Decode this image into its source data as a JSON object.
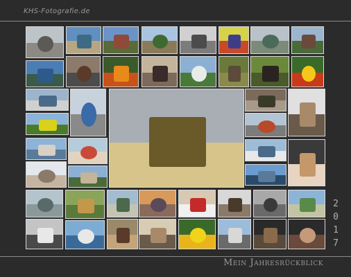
{
  "brand": "KHS-Fotografie.de",
  "caption": "Mein Jahresrückblick",
  "year_digits": [
    "2",
    "0",
    "1",
    "7"
  ],
  "photos": [
    {
      "name": "photo-bear-sculpture",
      "colors": [
        "#bcc4c8",
        "#5c5a56",
        "#8d8a83"
      ]
    },
    {
      "name": "photo-harbor",
      "colors": [
        "#5f90c0",
        "#3d6b86",
        "#b8a680"
      ]
    },
    {
      "name": "photo-holstentor",
      "colors": [
        "#6a94c8",
        "#8f4a3a",
        "#5a6b3a"
      ]
    },
    {
      "name": "photo-castle-lake",
      "colors": [
        "#a8c4e0",
        "#3f6a2f",
        "#8a7a5a"
      ]
    },
    {
      "name": "photo-half-timbered-house",
      "colors": [
        "#d0d0d0",
        "#4c4c4c",
        "#7c7c7c"
      ]
    },
    {
      "name": "photo-graffiti",
      "colors": [
        "#d6d24a",
        "#3d3d8a",
        "#c84a2a"
      ]
    },
    {
      "name": "photo-mountain-lake",
      "colors": [
        "#b8c2c8",
        "#4c6a5a",
        "#7c8a7a"
      ]
    },
    {
      "name": "photo-wooden-house",
      "colors": [
        "#9cb4cc",
        "#6a4a3a",
        "#4a6a3a"
      ]
    },
    {
      "name": "photo-fjord",
      "colors": [
        "#4c7cb4",
        "#2d5a8a",
        "#3a5a4a"
      ]
    },
    {
      "name": "photo-old-buildings",
      "colors": [
        "#8c7a6a",
        "#5c3a2a",
        "#4c4c4c"
      ]
    },
    {
      "name": "photo-orange-flowers",
      "colors": [
        "#3a5a2a",
        "#e88a1a",
        "#c8521a"
      ]
    },
    {
      "name": "photo-doorway",
      "colors": [
        "#c4b49c",
        "#3a2a2a",
        "#7c6a5a"
      ]
    },
    {
      "name": "photo-ski-jump",
      "colors": [
        "#8cb0d4",
        "#e8ece8",
        "#4a7a3a"
      ]
    },
    {
      "name": "photo-reindeer",
      "colors": [
        "#6a7a3a",
        "#5c4a3a",
        "#8a8a4a"
      ]
    },
    {
      "name": "photo-brown-bear",
      "colors": [
        "#6a8a3a",
        "#2a2420",
        "#4a5a2a"
      ]
    },
    {
      "name": "photo-yellow-flower",
      "colors": [
        "#3a6a2a",
        "#f4c81a",
        "#c83a1a"
      ]
    },
    {
      "name": "photo-marina",
      "colors": [
        "#9cb4cc",
        "#4a6a8a",
        "#d0d0d0"
      ]
    },
    {
      "name": "photo-rapeseed-field",
      "colors": [
        "#8cb4d8",
        "#d8d21a",
        "#4a7a2a"
      ]
    },
    {
      "name": "photo-signpost",
      "colors": [
        "#c8d2dc",
        "#3a6aa8",
        "#8a8a8a"
      ]
    },
    {
      "name": "photo-tram-square",
      "colors": [
        "#a8aeb4",
        "#6a5a2a",
        "#d6c48a"
      ]
    },
    {
      "name": "photo-people-crowd",
      "colors": [
        "#7c6a5a",
        "#3a3a2a",
        "#a89a8a"
      ]
    },
    {
      "name": "photo-red-building",
      "colors": [
        "#b4c4d4",
        "#b84a2a",
        "#7c7c7c"
      ]
    },
    {
      "name": "photo-lynx",
      "colors": [
        "#e0e0e0",
        "#a88a6a",
        "#6a5a4a"
      ]
    },
    {
      "name": "photo-harbor-hotel",
      "colors": [
        "#8cb4d8",
        "#d8d0c4",
        "#5a7a9a"
      ]
    },
    {
      "name": "photo-beach-chairs",
      "colors": [
        "#b4ccdc",
        "#c84a3a",
        "#e0d4c0"
      ]
    },
    {
      "name": "photo-sailing-ship",
      "colors": [
        "#9cbcd8",
        "#4a6a8a",
        "#e8e8e8"
      ]
    },
    {
      "name": "photo-woman-portrait",
      "colors": [
        "#3a3a3a",
        "#c4986a",
        "#e8d4c0"
      ]
    },
    {
      "name": "photo-husky",
      "colors": [
        "#e4e8ec",
        "#8a7a6a",
        "#c4b4a0"
      ]
    },
    {
      "name": "photo-palace",
      "colors": [
        "#8cb0d4",
        "#c4b498",
        "#4a6a3a"
      ]
    },
    {
      "name": "photo-bridge",
      "colors": [
        "#6a9cd0",
        "#5a7a9a",
        "#2a4a6a"
      ]
    },
    {
      "name": "photo-rowboats",
      "colors": [
        "#b4c4cc",
        "#5a6a6a",
        "#8a9a9a"
      ]
    },
    {
      "name": "photo-girl-grass",
      "colors": [
        "#8aa45a",
        "#c4984a",
        "#5a7a3a"
      ]
    },
    {
      "name": "photo-lake-house",
      "colors": [
        "#a4bcd0",
        "#4a6a4a",
        "#c4c4b4"
      ]
    },
    {
      "name": "photo-city-sunset",
      "colors": [
        "#d89a5a",
        "#5a4a5a",
        "#8a6a5a"
      ]
    },
    {
      "name": "photo-santa-claus",
      "colors": [
        "#d8c8b4",
        "#c42a2a",
        "#f0f0f0"
      ]
    },
    {
      "name": "photo-pirate-figure",
      "colors": [
        "#d8d8d8",
        "#4a3a2a",
        "#8a7a6a"
      ]
    },
    {
      "name": "photo-runner",
      "colors": [
        "#a8a8a8",
        "#3a3a3a",
        "#6a6a6a"
      ]
    },
    {
      "name": "photo-coastline",
      "colors": [
        "#8cb4d8",
        "#5a8a4a",
        "#c4c4a4"
      ]
    },
    {
      "name": "photo-vintage-car",
      "colors": [
        "#c4c4c4",
        "#e8e8e8",
        "#4a4a4a"
      ]
    },
    {
      "name": "photo-ferry-boat",
      "colors": [
        "#7cacd4",
        "#e8e8e8",
        "#3a6a9a"
      ]
    },
    {
      "name": "photo-bagpiper",
      "colors": [
        "#9a8a6a",
        "#5a3a2a",
        "#c4a47a"
      ]
    },
    {
      "name": "photo-meerkat",
      "colors": [
        "#d8ccb4",
        "#a88a6a",
        "#6a5a4a"
      ]
    },
    {
      "name": "photo-sunflowers",
      "colors": [
        "#3a6a2a",
        "#f0d41a",
        "#e8b41a"
      ]
    },
    {
      "name": "photo-cathedral",
      "colors": [
        "#9cbcdc",
        "#d8d8d8",
        "#6a6a6a"
      ]
    },
    {
      "name": "photo-statue-head",
      "colors": [
        "#2a2a2a",
        "#8a6a4a",
        "#5a4a3a"
      ]
    },
    {
      "name": "photo-woman-laptop",
      "colors": [
        "#2a2a2a",
        "#c49a7a",
        "#6a4a3a"
      ]
    }
  ]
}
